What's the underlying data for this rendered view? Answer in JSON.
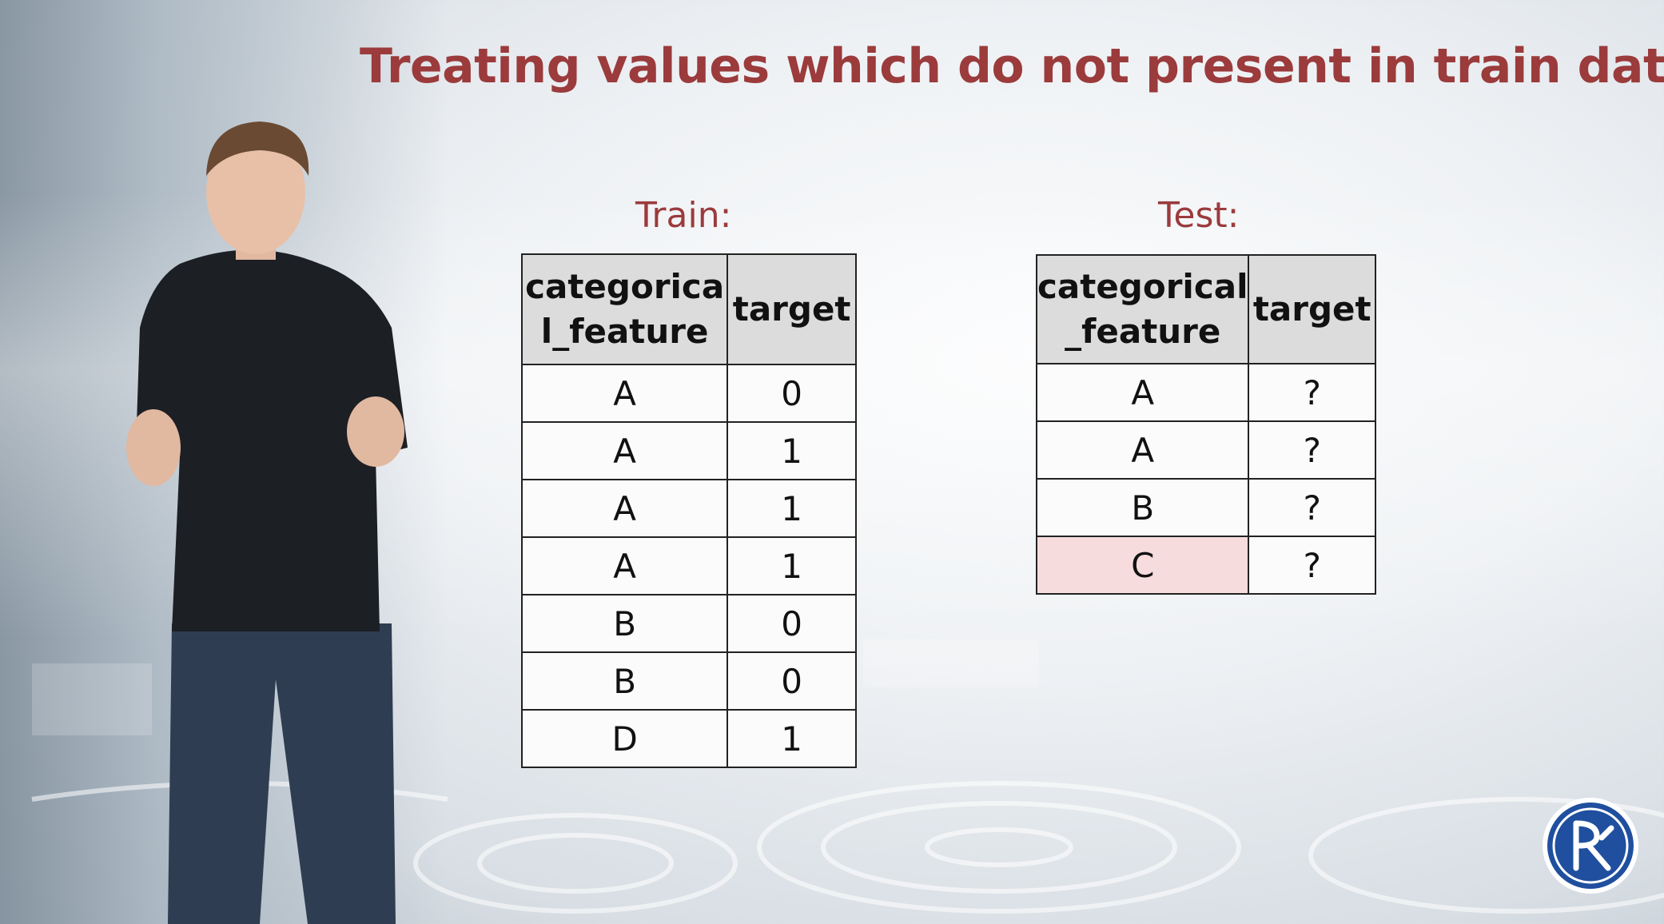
{
  "slide": {
    "title": "Treating values which do not present in train data"
  },
  "train": {
    "label": "Train:",
    "headers": [
      "categorica\nl_feature",
      "target"
    ],
    "rows": [
      [
        "A",
        "0"
      ],
      [
        "A",
        "1"
      ],
      [
        "A",
        "1"
      ],
      [
        "A",
        "1"
      ],
      [
        "B",
        "0"
      ],
      [
        "B",
        "0"
      ],
      [
        "D",
        "1"
      ]
    ]
  },
  "test": {
    "label": "Test:",
    "headers": [
      "categorical\n_feature",
      "target"
    ],
    "rows": [
      [
        "A",
        "?"
      ],
      [
        "A",
        "?"
      ],
      [
        "B",
        "?"
      ],
      [
        "C",
        "?"
      ]
    ],
    "highlighted_row": 3,
    "highlight_color": "#f6dcdc"
  },
  "colors": {
    "title": "#9b3b3c",
    "header_bg": "#dcdcdc",
    "logo_blue": "#1f4f9e"
  },
  "logo": {
    "icon": "university-logo-icon"
  }
}
